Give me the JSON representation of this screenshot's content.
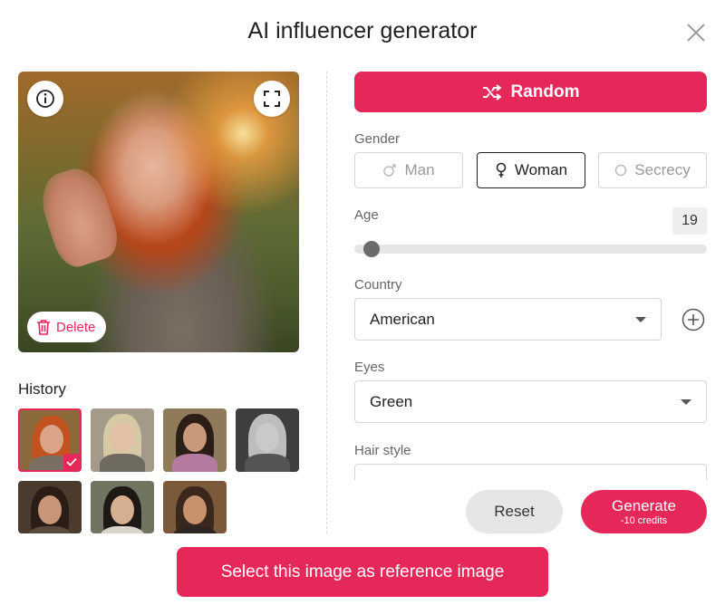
{
  "dialog": {
    "title": "AI influencer generator"
  },
  "preview": {
    "delete_label": "Delete"
  },
  "history": {
    "label": "History",
    "thumbs": [
      {
        "bg": "#8a6a3a",
        "hair": "#c2521f",
        "face": "#d9a487",
        "body": "#7b6f64"
      },
      {
        "bg": "#a49a8a",
        "hair": "#d8c9a6",
        "face": "#e3c0a4",
        "body": "#6f6a5f"
      },
      {
        "bg": "#8f7a5a",
        "hair": "#2b1e17",
        "face": "#c99a7a",
        "body": "#b57aa0"
      },
      {
        "bg": "#3e3e3e",
        "hair": "#bdbdbd",
        "face": "#c9c9c9",
        "body": "#555555"
      },
      {
        "bg": "#4b3a2e",
        "hair": "#2a1d16",
        "face": "#c89677",
        "body": "#5a4a3e"
      },
      {
        "bg": "#6f7560",
        "hair": "#1f1915",
        "face": "#d6ae90",
        "body": "#d9d3c8"
      },
      {
        "bg": "#7a5a3a",
        "hair": "#3b271b",
        "face": "#c8926f",
        "body": "#2e2420"
      }
    ]
  },
  "form": {
    "random_label": "Random",
    "gender": {
      "label": "Gender",
      "options": [
        "Man",
        "Woman",
        "Secrecy"
      ],
      "selected": "Woman"
    },
    "age": {
      "label": "Age",
      "value": "19",
      "fraction": 0.02
    },
    "country": {
      "label": "Country",
      "value": "American"
    },
    "eyes": {
      "label": "Eyes",
      "value": "Green"
    },
    "hair_style": {
      "label": "Hair style"
    }
  },
  "actions": {
    "reset_label": "Reset",
    "generate_label": "Generate",
    "generate_credits": "-10 credits",
    "select_reference_label": "Select this image as reference image"
  },
  "colors": {
    "accent": "#e5275a"
  }
}
